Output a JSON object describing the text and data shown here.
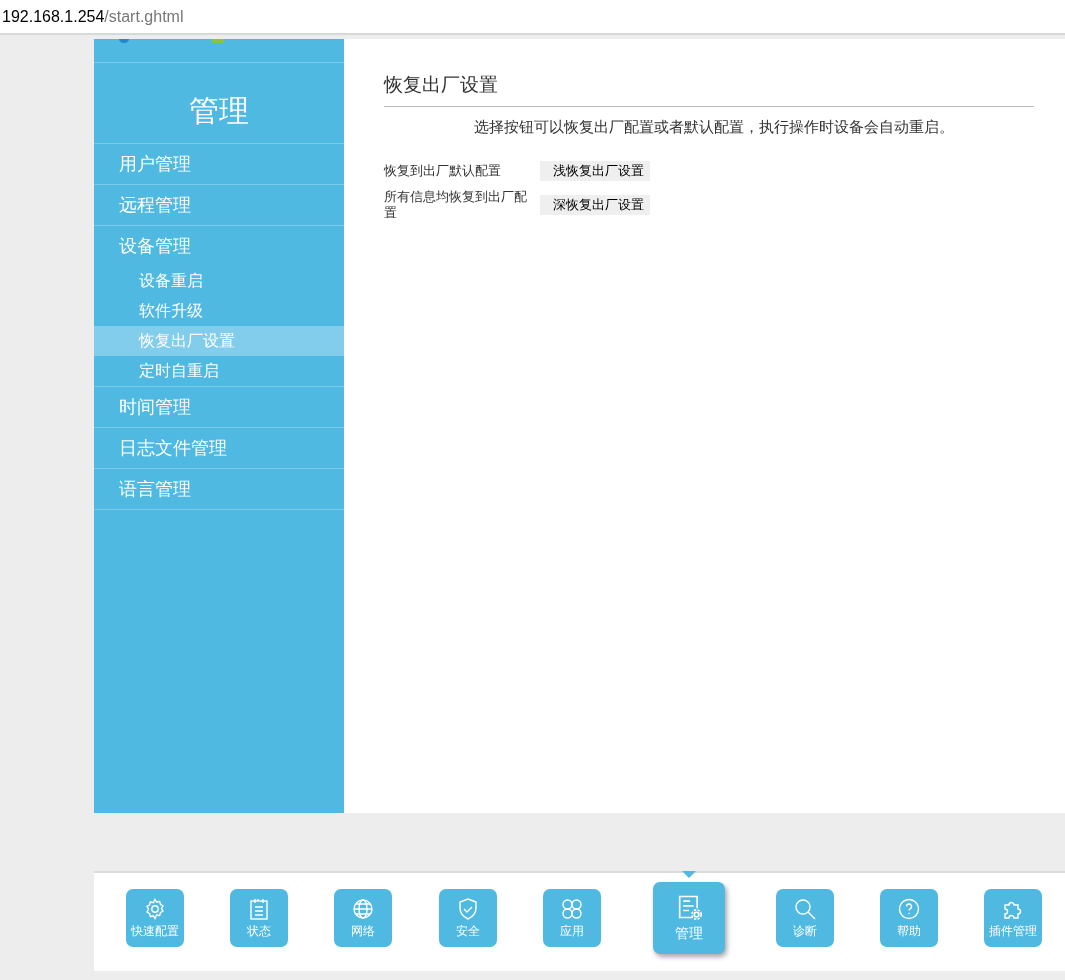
{
  "address_bar": {
    "host": "192.168.1.254",
    "path": "/start.ghtml"
  },
  "sidebar": {
    "title": "管理",
    "items": [
      {
        "label": "用户管理",
        "selected": false
      },
      {
        "label": "远程管理",
        "selected": false
      },
      {
        "label": "设备管理",
        "selected": false,
        "children": [
          {
            "label": "设备重启",
            "selected": false
          },
          {
            "label": "软件升级",
            "selected": false
          },
          {
            "label": "恢复出厂设置",
            "selected": true
          },
          {
            "label": "定时自重启",
            "selected": false
          }
        ]
      },
      {
        "label": "时间管理",
        "selected": false
      },
      {
        "label": "日志文件管理",
        "selected": false
      },
      {
        "label": "语言管理",
        "selected": false
      }
    ]
  },
  "content": {
    "title": "恢复出厂设置",
    "description": "选择按钮可以恢复出厂配置或者默认配置，执行操作时设备会自动重启。",
    "rows": [
      {
        "label": "恢复到出厂默认配置",
        "button": "浅恢复出厂设置"
      },
      {
        "label": "所有信息均恢复到出厂配置",
        "button": "深恢复出厂设置"
      }
    ]
  },
  "bottom_nav": [
    {
      "label": "快速配置",
      "selected": false
    },
    {
      "label": "状态",
      "selected": false
    },
    {
      "label": "网络",
      "selected": false
    },
    {
      "label": "安全",
      "selected": false
    },
    {
      "label": "应用",
      "selected": false
    },
    {
      "label": "管理",
      "selected": true
    },
    {
      "label": "诊断",
      "selected": false
    },
    {
      "label": "帮助",
      "selected": false
    },
    {
      "label": "插件管理",
      "selected": false
    }
  ]
}
